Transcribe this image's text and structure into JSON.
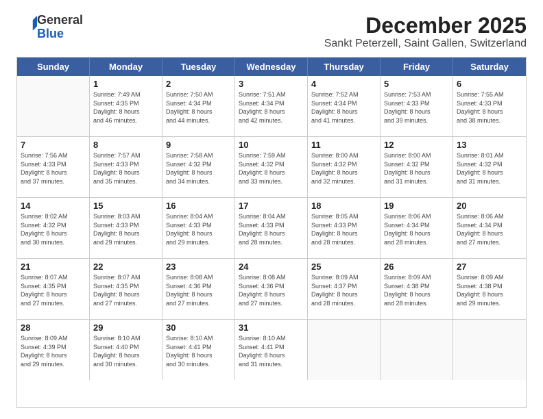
{
  "header": {
    "logo_general": "General",
    "logo_blue": "Blue",
    "title": "December 2025",
    "subtitle": "Sankt Peterzell, Saint Gallen, Switzerland"
  },
  "calendar": {
    "days_of_week": [
      "Sunday",
      "Monday",
      "Tuesday",
      "Wednesday",
      "Thursday",
      "Friday",
      "Saturday"
    ],
    "weeks": [
      [
        {
          "day": "",
          "info": ""
        },
        {
          "day": "1",
          "info": "Sunrise: 7:49 AM\nSunset: 4:35 PM\nDaylight: 8 hours\nand 46 minutes."
        },
        {
          "day": "2",
          "info": "Sunrise: 7:50 AM\nSunset: 4:34 PM\nDaylight: 8 hours\nand 44 minutes."
        },
        {
          "day": "3",
          "info": "Sunrise: 7:51 AM\nSunset: 4:34 PM\nDaylight: 8 hours\nand 42 minutes."
        },
        {
          "day": "4",
          "info": "Sunrise: 7:52 AM\nSunset: 4:34 PM\nDaylight: 8 hours\nand 41 minutes."
        },
        {
          "day": "5",
          "info": "Sunrise: 7:53 AM\nSunset: 4:33 PM\nDaylight: 8 hours\nand 39 minutes."
        },
        {
          "day": "6",
          "info": "Sunrise: 7:55 AM\nSunset: 4:33 PM\nDaylight: 8 hours\nand 38 minutes."
        }
      ],
      [
        {
          "day": "7",
          "info": "Sunrise: 7:56 AM\nSunset: 4:33 PM\nDaylight: 8 hours\nand 37 minutes."
        },
        {
          "day": "8",
          "info": "Sunrise: 7:57 AM\nSunset: 4:33 PM\nDaylight: 8 hours\nand 35 minutes."
        },
        {
          "day": "9",
          "info": "Sunrise: 7:58 AM\nSunset: 4:32 PM\nDaylight: 8 hours\nand 34 minutes."
        },
        {
          "day": "10",
          "info": "Sunrise: 7:59 AM\nSunset: 4:32 PM\nDaylight: 8 hours\nand 33 minutes."
        },
        {
          "day": "11",
          "info": "Sunrise: 8:00 AM\nSunset: 4:32 PM\nDaylight: 8 hours\nand 32 minutes."
        },
        {
          "day": "12",
          "info": "Sunrise: 8:00 AM\nSunset: 4:32 PM\nDaylight: 8 hours\nand 31 minutes."
        },
        {
          "day": "13",
          "info": "Sunrise: 8:01 AM\nSunset: 4:32 PM\nDaylight: 8 hours\nand 31 minutes."
        }
      ],
      [
        {
          "day": "14",
          "info": "Sunrise: 8:02 AM\nSunset: 4:32 PM\nDaylight: 8 hours\nand 30 minutes."
        },
        {
          "day": "15",
          "info": "Sunrise: 8:03 AM\nSunset: 4:33 PM\nDaylight: 8 hours\nand 29 minutes."
        },
        {
          "day": "16",
          "info": "Sunrise: 8:04 AM\nSunset: 4:33 PM\nDaylight: 8 hours\nand 29 minutes."
        },
        {
          "day": "17",
          "info": "Sunrise: 8:04 AM\nSunset: 4:33 PM\nDaylight: 8 hours\nand 28 minutes."
        },
        {
          "day": "18",
          "info": "Sunrise: 8:05 AM\nSunset: 4:33 PM\nDaylight: 8 hours\nand 28 minutes."
        },
        {
          "day": "19",
          "info": "Sunrise: 8:06 AM\nSunset: 4:34 PM\nDaylight: 8 hours\nand 28 minutes."
        },
        {
          "day": "20",
          "info": "Sunrise: 8:06 AM\nSunset: 4:34 PM\nDaylight: 8 hours\nand 27 minutes."
        }
      ],
      [
        {
          "day": "21",
          "info": "Sunrise: 8:07 AM\nSunset: 4:35 PM\nDaylight: 8 hours\nand 27 minutes."
        },
        {
          "day": "22",
          "info": "Sunrise: 8:07 AM\nSunset: 4:35 PM\nDaylight: 8 hours\nand 27 minutes."
        },
        {
          "day": "23",
          "info": "Sunrise: 8:08 AM\nSunset: 4:36 PM\nDaylight: 8 hours\nand 27 minutes."
        },
        {
          "day": "24",
          "info": "Sunrise: 8:08 AM\nSunset: 4:36 PM\nDaylight: 8 hours\nand 27 minutes."
        },
        {
          "day": "25",
          "info": "Sunrise: 8:09 AM\nSunset: 4:37 PM\nDaylight: 8 hours\nand 28 minutes."
        },
        {
          "day": "26",
          "info": "Sunrise: 8:09 AM\nSunset: 4:38 PM\nDaylight: 8 hours\nand 28 minutes."
        },
        {
          "day": "27",
          "info": "Sunrise: 8:09 AM\nSunset: 4:38 PM\nDaylight: 8 hours\nand 29 minutes."
        }
      ],
      [
        {
          "day": "28",
          "info": "Sunrise: 8:09 AM\nSunset: 4:39 PM\nDaylight: 8 hours\nand 29 minutes."
        },
        {
          "day": "29",
          "info": "Sunrise: 8:10 AM\nSunset: 4:40 PM\nDaylight: 8 hours\nand 30 minutes."
        },
        {
          "day": "30",
          "info": "Sunrise: 8:10 AM\nSunset: 4:41 PM\nDaylight: 8 hours\nand 30 minutes."
        },
        {
          "day": "31",
          "info": "Sunrise: 8:10 AM\nSunset: 4:41 PM\nDaylight: 8 hours\nand 31 minutes."
        },
        {
          "day": "",
          "info": ""
        },
        {
          "day": "",
          "info": ""
        },
        {
          "day": "",
          "info": ""
        }
      ]
    ]
  }
}
